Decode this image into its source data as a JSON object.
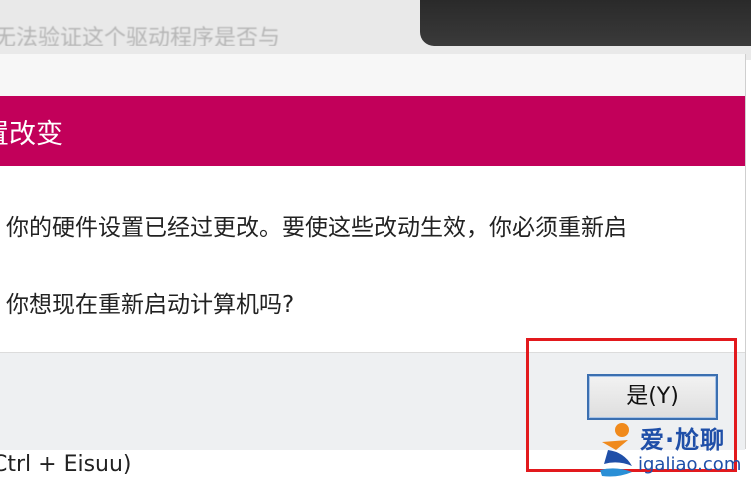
{
  "background": {
    "window_text": "无法验证这个驱动程序是否与",
    "shortcut_text": "Ctrl + Eisuu)"
  },
  "dialog": {
    "title": "置改变",
    "message_line1": "你的硬件设置已经过更改。要使这些改动生效，你必须重新启",
    "message_line2": "你想现在重新启动计算机吗?",
    "yes_button_label": "是(Y)",
    "title_color": "#c2005a"
  },
  "watermark": {
    "top_text": "爱·尬聊",
    "bottom_text": "igaliao.com"
  },
  "highlight": {
    "color": "#e2191d"
  }
}
